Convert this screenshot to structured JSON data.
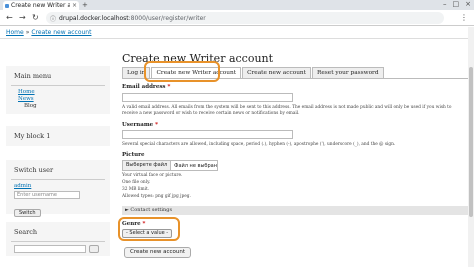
{
  "browser": {
    "tab_title": "Create new Writer account",
    "tab_close": "×",
    "new_tab": "+",
    "url_host": "drupal.docker.localhost",
    "url_path": ":8000/user/register/writer",
    "back": "←",
    "forward": "→",
    "reload": "↻",
    "menu": "⋮",
    "minimize": "–",
    "maximize": "□",
    "close": "×"
  },
  "breadcrumb": {
    "home": "Home",
    "separator": "»",
    "current": "Create new account"
  },
  "sidebar": {
    "main_menu_title": "Main menu",
    "menu_items": [
      "Home",
      "News",
      "Blog"
    ],
    "my_block_title": "My block 1",
    "switch_user_title": "Switch user",
    "switch_user_link": "admin",
    "username_placeholder": "Enter username",
    "switch_button": "Switch",
    "search_title": "Search"
  },
  "main": {
    "title": "Create new Writer account",
    "tabs": [
      "Log in",
      "Create new Writer account",
      "Create new account",
      "Reset your password"
    ],
    "email_label": "Email address",
    "email_desc": "A valid email address. All emails from the system will be sent to this address. The email address is not made public and will only be used if you wish to receive a new password or wish to receive certain news or notifications by email.",
    "username_label": "Username",
    "username_desc": "Several special characters are allowed, including space, period (.), hyphen (-), apostrophe ('), underscore (_), and the @ sign.",
    "picture_label": "Picture",
    "file_choose": "Выберете файл",
    "file_none": "Файл не выбран",
    "picture_desc": [
      "Your virtual face or picture.",
      "One file only.",
      "32 MB limit.",
      "Allowed types: png gif jpg jpeg."
    ],
    "contact_settings": "► Contact settings",
    "genre_label": "Genre",
    "genre_value": "- Select a value -",
    "submit": "Create new account",
    "required_mark": "*"
  }
}
